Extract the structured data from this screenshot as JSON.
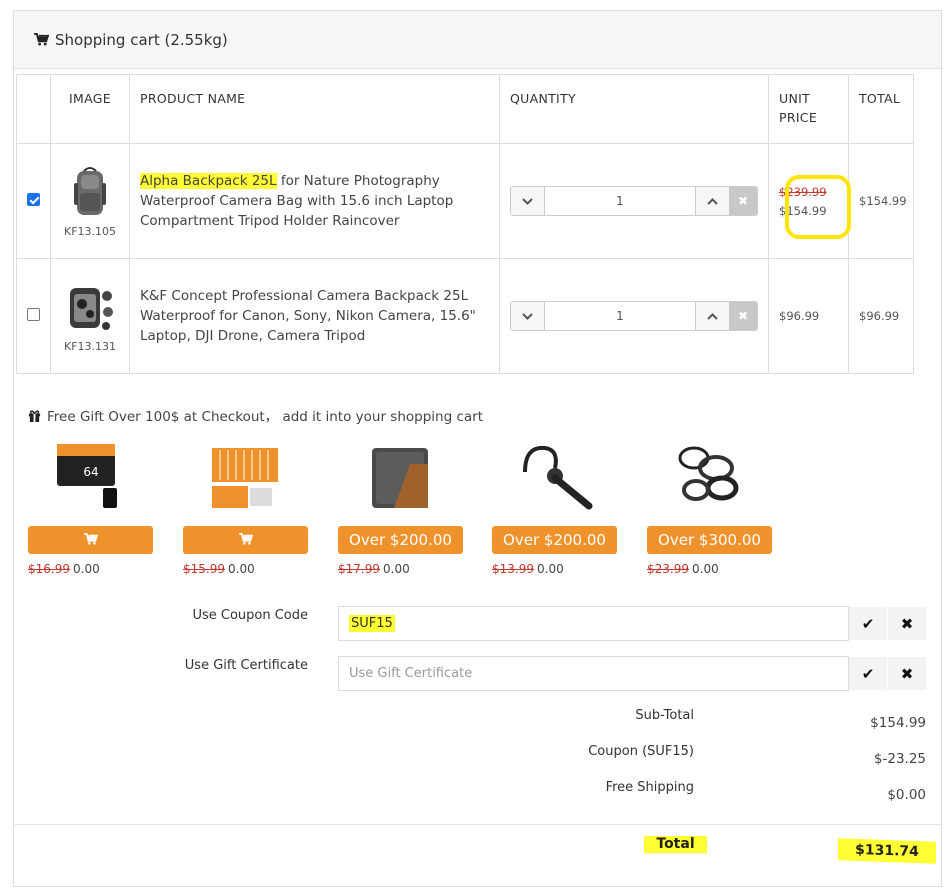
{
  "cart": {
    "title": "Shopping cart (2.55kg)",
    "columns": [
      "IMAGE",
      "PRODUCT NAME",
      "QUANTITY",
      "UNIT PRICE",
      "TOTAL"
    ],
    "items": [
      {
        "checked": true,
        "sku": "KF13.105",
        "name_highlight": "Alpha Backpack 25L",
        "name_rest": " for Nature Photography Waterproof Camera Bag with 15.6 inch Laptop Compartment Tripod Holder Raincover",
        "quantity": "1",
        "old_price": "$239.99",
        "unit_price": "$154.99",
        "total": "$154.99"
      },
      {
        "checked": false,
        "sku": "KF13.131",
        "name": "K&F Concept Professional Camera Backpack 25L Waterproof for Canon, Sony, Nikon Camera, 15.6\" Laptop, DJI Drone, Camera Tripod",
        "quantity": "1",
        "unit_price": "$96.99",
        "total": "$96.99"
      }
    ]
  },
  "gifts": {
    "title": "Free Gift Over 100$ at Checkout，  add it into your shopping cart",
    "items": [
      {
        "button": "",
        "old_price": "$16.99",
        "price": "0.00"
      },
      {
        "button": "",
        "old_price": "$15.99",
        "price": "0.00"
      },
      {
        "button": "Over $200.00",
        "old_price": "$17.99",
        "price": "0.00"
      },
      {
        "button": "Over $200.00",
        "old_price": "$13.99",
        "price": "0.00"
      },
      {
        "button": "Over $300.00",
        "old_price": "$23.99",
        "price": "0.00"
      }
    ]
  },
  "coupon": {
    "label": "Use Coupon Code",
    "value": "SUF15"
  },
  "gift_cert": {
    "label": "Use Gift Certificate",
    "placeholder": "Use Gift Certificate"
  },
  "summary": {
    "subtotal_label": "Sub-Total",
    "subtotal": "$154.99",
    "coupon_label": "Coupon (SUF15)",
    "coupon": "$-23.25",
    "shipping_label": "Free Shipping",
    "shipping": "$0.00",
    "total_label": "Total",
    "total": "$131.74"
  },
  "colors": {
    "accent": "#f0922b",
    "highlight": "#ffff33",
    "strike": "#c0392b",
    "check": "#1a73e8"
  }
}
